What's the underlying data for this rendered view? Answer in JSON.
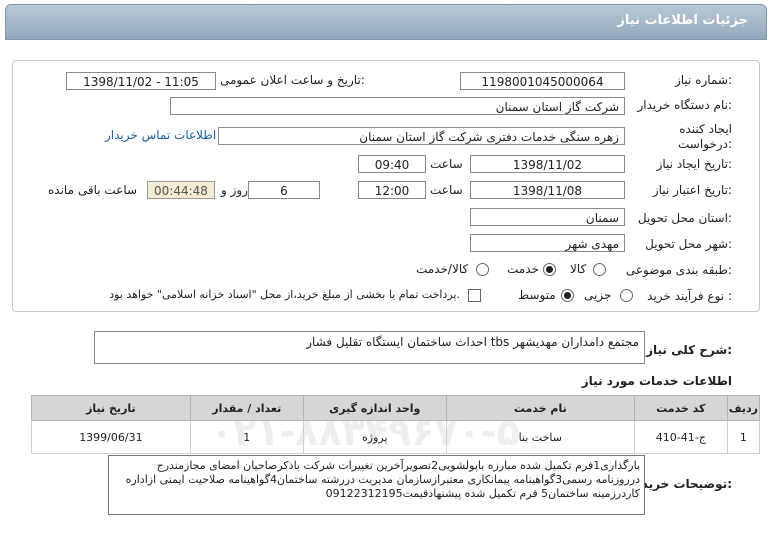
{
  "page_title": "جزئیات اطلاعات نیاز",
  "fields": {
    "need_number_label": "شماره نیاز:",
    "need_number": "1198001045000064",
    "announce_label": "تاریخ و ساعت اعلان عمومی:",
    "announce_value": "1398/11/02 - 11:05",
    "buyer_label": "نام دستگاه خریدار:",
    "buyer": "شرکت گاز استان سمنان",
    "creator_label_1": "ایجاد کننده",
    "creator_label_2": "درخواست:",
    "creator": "زهره سنگی خدمات دفتری شرکت گاز استان سمنان",
    "contact_link": "اطلاعات تماس خریدار",
    "create_date_label": "تاریخ ایجاد نیاز:",
    "create_date": "1398/11/02",
    "time_label": "ساعت",
    "create_time": "09:40",
    "valid_date_label": "تاریخ اعتبار نیاز:",
    "valid_date": "1398/11/08",
    "valid_time": "12:00",
    "days_value": "6",
    "days_label": "روز و",
    "remaining_time": "00:44:48",
    "remaining_label": "ساعت باقی مانده",
    "province_label": "استان محل تحویل:",
    "province": "سمنان",
    "city_label": "شهر محل تحویل:",
    "city": "مهدی شهر",
    "category_label": "طبقه بندی موضوعی:",
    "category_options": [
      "کالا",
      "خدمت",
      "کالا/خدمت"
    ],
    "category_selected": "خدمت",
    "process_label": "نوع فرآیند خرید :",
    "process_options": [
      "جزیی",
      "متوسط"
    ],
    "process_selected": "متوسط",
    "payment_note": "پرداخت تمام یا بخشی از مبلغ خرید،از محل \"اسناد خزانه اسلامی\" خواهد بود."
  },
  "summary": {
    "label": "شرح کلی نیاز:",
    "value": "احداث ساختمان ایستگاه تقلیل فشار tbs مجتمع دامداران مهدیشهر"
  },
  "services": {
    "section_title": "اطلاعات خدمات مورد نیاز",
    "headers": [
      "ردیف",
      "کد خدمت",
      "نام خدمت",
      "واحد اندازه گیری",
      "تعداد / مقدار",
      "تاریخ نیاز"
    ],
    "rows": [
      {
        "row": "1",
        "code": "ج-41-410",
        "name": "ساخت بنا",
        "unit": "پروژه",
        "qty": "1",
        "date": "1399/06/31"
      }
    ]
  },
  "buyer_notes": {
    "label": "توضیحات خریدار:",
    "value": "بارگذاری1فرم تکمیل شده مبارزه باپولشویی2تصویرآخرین تغییرات شرکت باذکرصاحیان امضای مجازمندرج درروزنامه رسمی3گواهینامه پیمانکاری معتبرازسازمان مدیریت دررشته ساختمان4گواهینامه صلاحیت ایمنی ازاداره کاردرزمینه ساختمان5 فرم تکمیل شده پیشنهادقیمت09122312195"
  }
}
